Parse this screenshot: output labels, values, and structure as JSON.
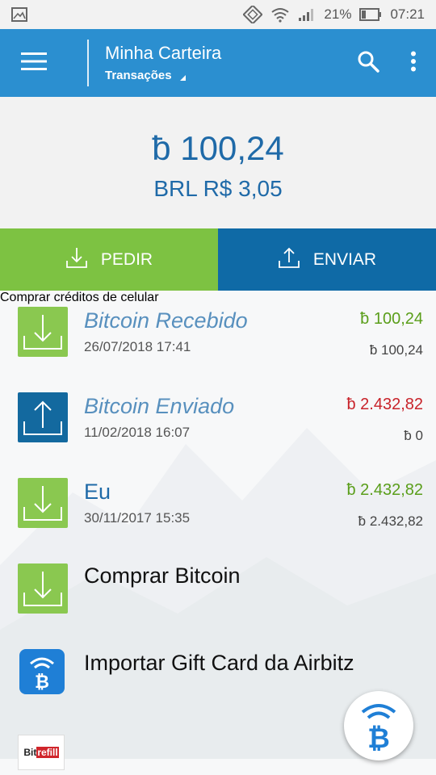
{
  "status_bar": {
    "battery_percent": "21%",
    "time": "07:21"
  },
  "app_bar": {
    "title": "Minha Carteira",
    "subtitle": "Transações"
  },
  "balance": {
    "btc": "ƀ 100,24",
    "fiat": "BRL R$ 3,05"
  },
  "actions": {
    "request_label": "PEDIR",
    "send_label": "ENVIAR"
  },
  "transactions": [
    {
      "name": "Bitcoin Recebido",
      "date": "26/07/2018 17:41",
      "amount": "ƀ 100,24",
      "amount_color": "#5a9e1a",
      "secondary": "ƀ 100,24",
      "icon": "receive-icon"
    },
    {
      "name": "Bitcoin Enviado",
      "date": "11/02/2018 16:07",
      "amount": "ƀ 2.432,82",
      "amount_color": "#c8232a",
      "secondary": "ƀ 0",
      "icon": "send-icon"
    },
    {
      "name": "Eu",
      "date": "30/11/2017 15:35",
      "amount": "ƀ 2.432,82",
      "amount_color": "#5a9e1a",
      "secondary": "ƀ 2.432,82",
      "icon": "receive-icon"
    }
  ],
  "menu_items": [
    {
      "label": "Comprar Bitcoin",
      "icon": "receive-icon"
    },
    {
      "label": "Importar Gift Card da Airbitz",
      "icon": "airbitz-icon"
    },
    {
      "label": "Comprar créditos de celular",
      "icon": "bitrefill-logo"
    }
  ],
  "bitrefill_logo": {
    "part1": "Bit",
    "part2": "refill"
  },
  "colors": {
    "primary": "#2b8fd0",
    "request": "#7dc242",
    "send": "#0f6aa6",
    "balance_text": "#1f6aa8"
  }
}
